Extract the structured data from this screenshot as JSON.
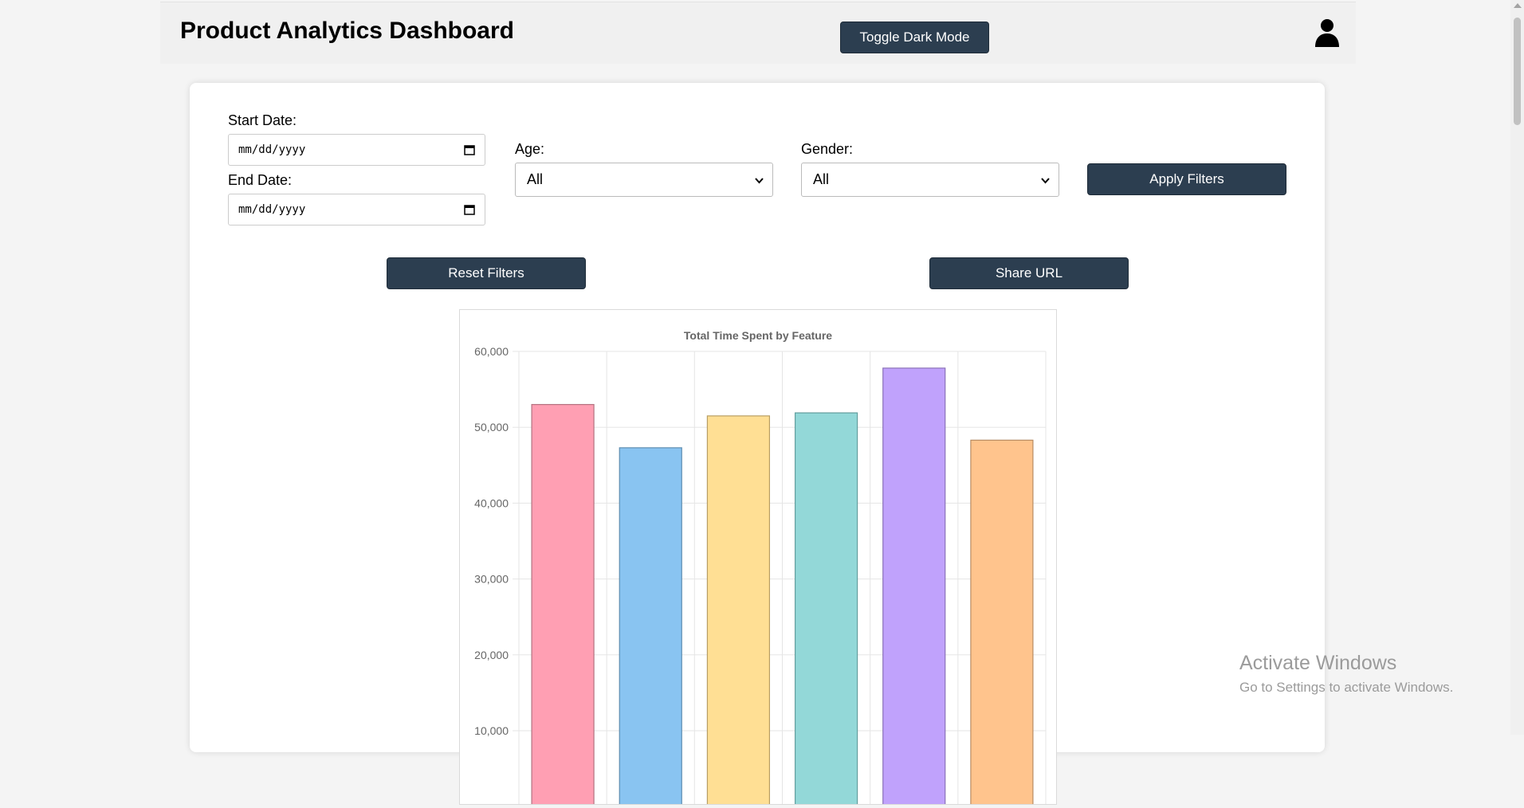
{
  "header": {
    "title": "Product Analytics Dashboard",
    "toggle_label": "Toggle Dark Mode",
    "user_icon": "user-icon"
  },
  "filters": {
    "start_date_label": "Start Date:",
    "start_date_placeholder": "mm/dd/yyyy",
    "end_date_label": "End Date:",
    "end_date_placeholder": "mm/dd/yyyy",
    "age_label": "Age:",
    "age_value": "All",
    "gender_label": "Gender:",
    "gender_value": "All",
    "apply_label": "Apply Filters",
    "reset_label": "Reset Filters",
    "share_label": "Share URL"
  },
  "chart_data": {
    "type": "bar",
    "title": "Total Time Spent by Feature",
    "categories": [
      "",
      "",
      "",
      "",
      "",
      ""
    ],
    "values": [
      53000,
      47300,
      51500,
      51900,
      57800,
      48300
    ],
    "colors": [
      "#ff9fb3",
      "#89c4f1",
      "#ffdf94",
      "#93d8d8",
      "#c0a2fc",
      "#ffc48d"
    ],
    "border_colors": [
      "#b37280",
      "#5f8eb0",
      "#b89e63",
      "#639e9e",
      "#8a71b8",
      "#b88b62"
    ],
    "y_ticks": [
      "60,000",
      "50,000",
      "40,000",
      "30,000",
      "20,000",
      "10,000"
    ],
    "y_tick_values": [
      60000,
      50000,
      40000,
      30000,
      20000,
      10000
    ],
    "ylim": [
      0,
      60000
    ],
    "grid": true
  },
  "watermark": {
    "line1": "Activate Windows",
    "line2": "Go to Settings to activate Windows."
  }
}
